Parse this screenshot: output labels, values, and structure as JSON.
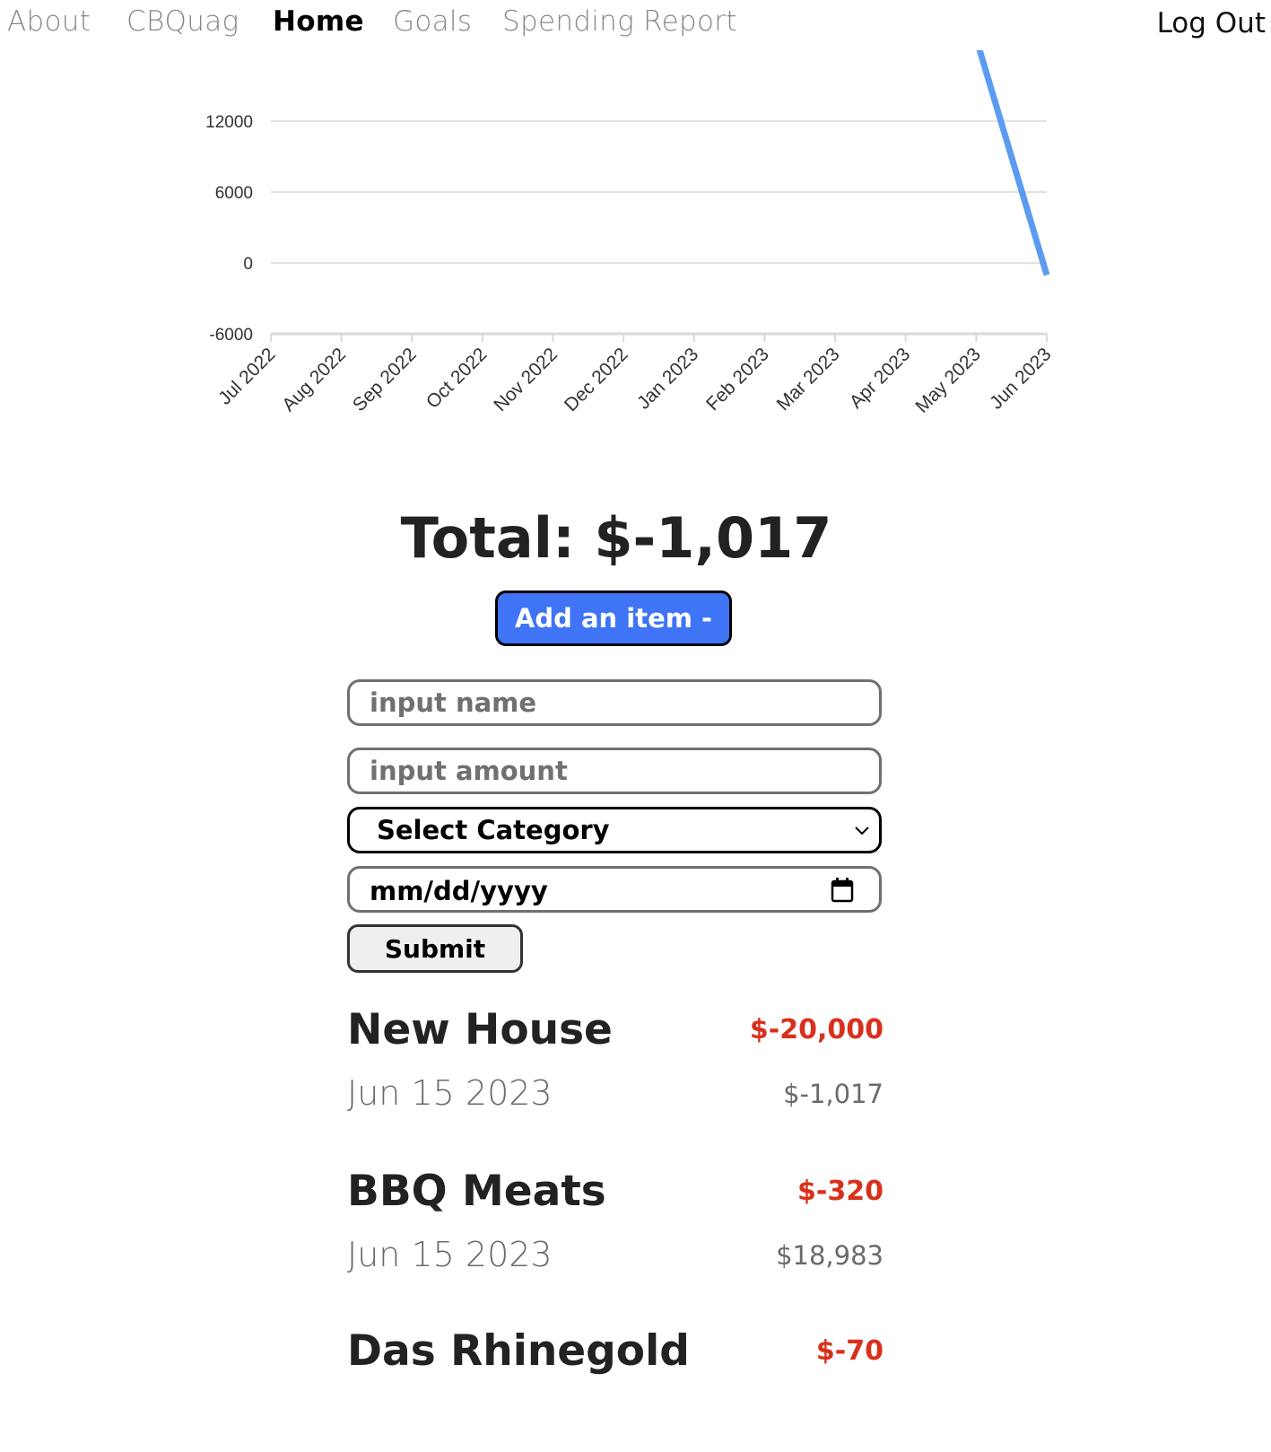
{
  "nav": {
    "links": [
      {
        "label": "About",
        "active": false
      },
      {
        "label": "CBQuag",
        "active": false
      },
      {
        "label": "Home",
        "active": true
      },
      {
        "label": "Goals",
        "active": false
      },
      {
        "label": "Spending Report",
        "active": false
      }
    ],
    "logout_label": "Log Out"
  },
  "chart_data": {
    "type": "line",
    "categories": [
      "Jul 2022",
      "Aug 2022",
      "Sep 2022",
      "Oct 2022",
      "Nov 2022",
      "Dec 2022",
      "Jan 2023",
      "Feb 2023",
      "Mar 2023",
      "Apr 2023",
      "May 2023",
      "Jun 2023"
    ],
    "y_ticks": [
      "12000",
      "6000",
      "0",
      "-6000"
    ],
    "ylim": [
      -6000,
      18000
    ],
    "series": [
      {
        "color": "#5b9cf1",
        "points": [
          {
            "x": "May 2023",
            "y": 18983
          },
          {
            "x": "Jun 2023",
            "y": -1017
          }
        ]
      }
    ],
    "grid": true
  },
  "total": {
    "label": "Total: $-1,017"
  },
  "add_button": {
    "label": "Add an item -"
  },
  "form": {
    "name_placeholder": "input name",
    "amount_placeholder": "input amount",
    "category_label": "Select Category",
    "date_placeholder": "mm/dd/yyyy",
    "submit_label": "Submit"
  },
  "transactions": [
    {
      "name": "New House",
      "amount": "$-20,000",
      "date": "Jun 15 2023",
      "balance": "$-1,017"
    },
    {
      "name": "BBQ Meats",
      "amount": "$-320",
      "date": "Jun 15 2023",
      "balance": "$18,983"
    },
    {
      "name": "Das Rhinegold",
      "amount": "$-70",
      "date": "",
      "balance": ""
    }
  ],
  "colors": {
    "accent": "#3e74f5",
    "negative": "#d9301c",
    "line": "#5b9cf1"
  }
}
